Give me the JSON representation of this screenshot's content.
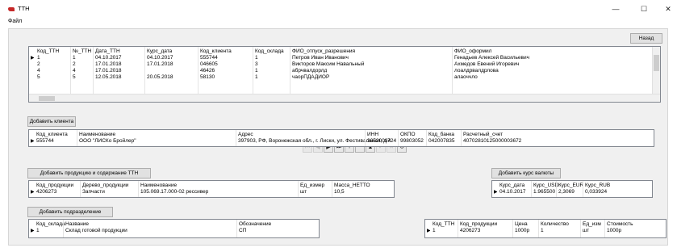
{
  "window": {
    "title": "ТТН",
    "minimize": "—",
    "maximize": "☐",
    "close": "✕"
  },
  "menu": {
    "file": "Файл"
  },
  "buttons": {
    "back": "Назад",
    "add_client": "Добавить клиента",
    "add_product": "Добавить продукцию и содержание ТТН",
    "add_rate": "Добавить курс валюты",
    "add_warehouse": "Добавить подразделение"
  },
  "ttn": {
    "headers": [
      "Код_ТТН",
      "№_ТТН",
      "Дата_ТТН",
      "Курс_дата",
      "Код_клиента",
      "Код_склада",
      "ФИО_отпуск_разрешения",
      "ФИО_оформил"
    ],
    "rows": [
      [
        "1",
        "1",
        "04.10.2017",
        "04.10.2017",
        "555744",
        "1",
        "Петров Иван Иванович",
        "Генадьев Алексей Васильевич"
      ],
      [
        "2",
        "2",
        "17.01.2018",
        "17.01.2018",
        "046605",
        "3",
        "Викторов Максим Навальный",
        "Ахмедов Евений Игоревич"
      ],
      [
        "4",
        "4",
        "17.01.2018",
        "",
        "46426",
        "1",
        "абрчвалдорлд",
        "лоалдрвалдрлова"
      ],
      [
        "5",
        "5",
        "12.05.2018",
        "20.05.2018",
        "58130",
        "1",
        "чаорПДАДИОР",
        "алаоччло"
      ]
    ]
  },
  "nav": [
    "⏮",
    "◀",
    "▶",
    "⏭",
    "+",
    "−",
    "▲",
    "✓",
    "✕",
    "↻"
  ],
  "client": {
    "headers": [
      "Код_клиента",
      "Наименование",
      "Адрес",
      "ИНН",
      "ОКПО",
      "Код_банка",
      "Расчетный_счет"
    ],
    "rows": [
      [
        "555744",
        "ООО \"ЛИСКо Бройлер\"",
        "397903, РФ, Воронежская обл., г. Лиски, ул. Фестивальная, д.4",
        "3652009724",
        "99803052",
        "042007835",
        "40702810125000003672"
      ]
    ]
  },
  "product": {
    "headers": [
      "Код_продукции",
      "Дерево_продукции",
      "Наименование",
      "Ед_измер",
      "Масса_НЕТТО"
    ],
    "rows": [
      [
        "4206273",
        "Запчасти",
        "105.069.17.000-02 рессивер",
        "шт",
        "10,5"
      ]
    ]
  },
  "rate": {
    "headers": [
      "Курс_дата",
      "Курс_USD",
      "Курс_EUR",
      "Курс_RUB"
    ],
    "rows": [
      [
        "04.10.2017",
        "1.965500",
        "2,3069",
        "0,033924"
      ]
    ]
  },
  "warehouse": {
    "headers": [
      "Код_склада",
      "Название",
      "Обозначение"
    ],
    "rows": [
      [
        "1",
        "Склад готовой продукции",
        "СП"
      ]
    ]
  },
  "content": {
    "headers": [
      "Код_ТТН",
      "Код_продукции",
      "Цена",
      "Количество",
      "Ед_изм",
      "Стоимость"
    ],
    "rows": [
      [
        "1",
        "4206273",
        "1000р",
        "1",
        "шт",
        "1000р"
      ]
    ]
  }
}
